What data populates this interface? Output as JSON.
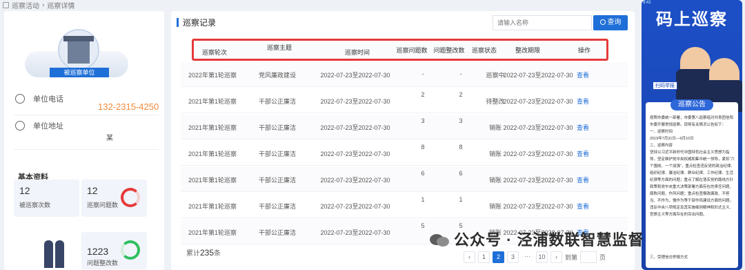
{
  "breadcrumb": [
    "巡察活动",
    "巡察详情"
  ],
  "unit": {
    "badge": "被巡察单位",
    "phone_label": "单位电话",
    "phone": "132-2315-4250",
    "address_label": "单位地址",
    "address": "某",
    "basic_title": "基本资料",
    "stats": [
      {
        "value": "12",
        "label": "被巡察次数"
      },
      {
        "value": "12",
        "label": "巡察问题数"
      },
      {
        "value": "1223",
        "label": "问题整改数"
      }
    ],
    "ring_colors": [
      "#e53a3a",
      "#2fbf5f"
    ]
  },
  "records": {
    "title": "巡察记录",
    "search_placeholder": "请输入名称",
    "query_label": "查询",
    "headers": [
      "巡察轮次",
      "巡察主题",
      "巡察时间",
      "巡察问题数",
      "问题整改数",
      "巡察状态",
      "整改期限",
      "操作"
    ],
    "rows": [
      [
        "2022年第1轮巡察",
        "党风廉政建设",
        "2022-07-23至2022-07-30",
        "-",
        "-",
        "巡察中",
        "2022-07-23至2022-07-30",
        "查看"
      ],
      [
        "2021年第1轮巡察",
        "干部公正廉洁",
        "2022-07-23至2022-07-30",
        "2",
        "2",
        "待整改",
        "2022-07-23至2022-07-30",
        "查看"
      ],
      [
        "2021年第1轮巡察",
        "干部公正廉洁",
        "2022-07-23至2022-07-30",
        "3",
        "3",
        "销账",
        "2022-07-23至2022-07-30",
        "查看"
      ],
      [
        "2021年第1轮巡察",
        "干部公正廉洁",
        "2022-07-23至2022-07-30",
        "8",
        "8",
        "销账",
        "2022-07-23至2022-07-30",
        "查看"
      ],
      [
        "2021年第1轮巡察",
        "干部公正廉洁",
        "2022-07-23至2022-07-30",
        "6",
        "6",
        "销账",
        "2022-07-23至2022-07-30",
        "查看"
      ],
      [
        "2021年第1轮巡察",
        "干部公正廉洁",
        "2022-07-23至2022-07-30",
        "1",
        "1",
        "销账",
        "2022-07-23至2022-07-30",
        "查看"
      ],
      [
        "2021年第1轮巡察",
        "干部公正廉洁",
        "2022-07-23至2022-07-30",
        "5",
        "5",
        "销账",
        "2022-07-23至2022-07-30",
        "查看"
      ]
    ],
    "total_prefix": "累计",
    "total": "235",
    "total_suffix": "条",
    "pages": [
      "1",
      "2",
      "3",
      "···",
      "10"
    ],
    "active_page": "2",
    "jump_label": "到第",
    "page_suffix": "页"
  },
  "phone_panel": {
    "status": "9:41",
    "banner": "码上巡察",
    "tag": "扫码举报",
    "notice_title": "巡察公告",
    "notice_lines": [
      "按照市委统一部署，市委第八巡察组对共青团信阳市委开展常规巡察。现将有关情况公告如下：",
      "一、巡察时间",
      "2019年7月31日—9月10日",
      "二、巡察内容",
      "坚持以习近平新时代中国特色社会主义思想为指导，坚定维护党中央权威和集中统一领导，紧扣“六个围绕、一个加强”，重点检查违反党的政治纪律、组织纪律、廉洁纪律、群众纪律、工作纪律、生活纪律等方面的问题；重点了解在落实党的路线方针政策和党中央重大决策部署方面存在的责任问题、腐败问题、作风问题；重点检查懒政庸政、不担当、不作为，慢作为等干部作风建设方面的问题。违反中央八项规定及其实施细则精神和形式主义、官僚主义等方面存在的突出问题。",
      "三、受理信访举报方式"
    ]
  },
  "watermark": "公众号 · 泾浦数联智慧监督"
}
